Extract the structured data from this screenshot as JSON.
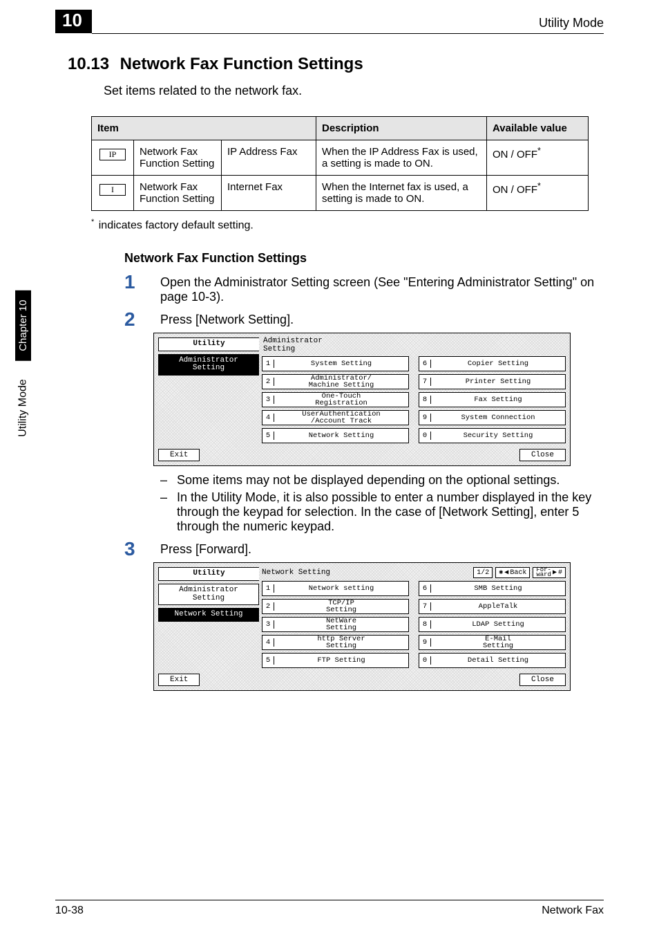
{
  "header": {
    "chapter_number": "10",
    "running_title": "Utility Mode"
  },
  "sidetab": {
    "label": "Utility Mode",
    "chapter": "Chapter 10"
  },
  "section": {
    "number": "10.13",
    "title": "Network Fax Function Settings",
    "intro": "Set items related to the network fax."
  },
  "table": {
    "headers": {
      "c1": "Item",
      "c2": "Description",
      "c3": "Available value"
    },
    "rows": [
      {
        "icon": "IP",
        "name": "Network Fax Function Setting",
        "sub": "IP Address Fax",
        "desc": "When the IP Address Fax is used, a setting is made to ON.",
        "val": "ON / OFF",
        "star": "*"
      },
      {
        "icon": "I",
        "name": "Network Fax Function Setting",
        "sub": "Internet Fax",
        "desc": "When the Internet fax is used, a setting is made to ON.",
        "val": "ON / OFF",
        "star": "*"
      }
    ]
  },
  "footnote": {
    "mark": "*",
    "text": "indicates factory default setting."
  },
  "subtitle": "Network Fax Function Settings",
  "steps": {
    "s1": "Open the Administrator Setting screen (See \"Entering Administrator Setting\" on page 10-3).",
    "s2": "Press [Network Setting].",
    "s2_note1": "Some items may not be displayed depending on the optional settings.",
    "s2_note2": "In the Utility Mode, it is also possible to enter a number displayed in the key through the keypad for selection. In the case of [Network Setting], enter 5 through the numeric keypad.",
    "s3": "Press [Forward]."
  },
  "lcd1": {
    "left_tab_title": "Utility",
    "left_tab_active": "Administrator\nSetting",
    "panel_title": "Administrator\nSetting",
    "buttons": [
      {
        "n": "1",
        "t": "System Setting"
      },
      {
        "n": "6",
        "t": "Copier Setting"
      },
      {
        "n": "2",
        "t": "Administrator/\nMachine Setting"
      },
      {
        "n": "7",
        "t": "Printer Setting"
      },
      {
        "n": "3",
        "t": "One-Touch\nRegistration"
      },
      {
        "n": "8",
        "t": "Fax Setting"
      },
      {
        "n": "4",
        "t": "UserAuthentication\n/Account Track"
      },
      {
        "n": "9",
        "t": "System Connection"
      },
      {
        "n": "5",
        "t": "Network Setting"
      },
      {
        "n": "0",
        "t": "Security Setting"
      }
    ],
    "foot_left": "Exit",
    "foot_right": "Close"
  },
  "lcd2": {
    "left_tab_title": "Utility",
    "left_tab1": "Administrator\nSetting",
    "left_tab_active": "Network Setting",
    "panel_title": "Network Setting",
    "pager": "1/2",
    "back_symbol": "✱",
    "back": "Back",
    "forward": "For-\nward",
    "fwd_symbol": "#",
    "buttons": [
      {
        "n": "1",
        "t": "Network setting"
      },
      {
        "n": "6",
        "t": "SMB Setting"
      },
      {
        "n": "2",
        "t": "TCP/IP\nSetting"
      },
      {
        "n": "7",
        "t": "AppleTalk"
      },
      {
        "n": "3",
        "t": "NetWare\nSetting"
      },
      {
        "n": "8",
        "t": "LDAP Setting"
      },
      {
        "n": "4",
        "t": "http Server\nSetting"
      },
      {
        "n": "9",
        "t": "E-Mail\nSetting"
      },
      {
        "n": "5",
        "t": "FTP Setting"
      },
      {
        "n": "0",
        "t": "Detail Setting"
      }
    ],
    "foot_left": "Exit",
    "foot_right": "Close"
  },
  "footer": {
    "page": "10-38",
    "title": "Network Fax"
  }
}
